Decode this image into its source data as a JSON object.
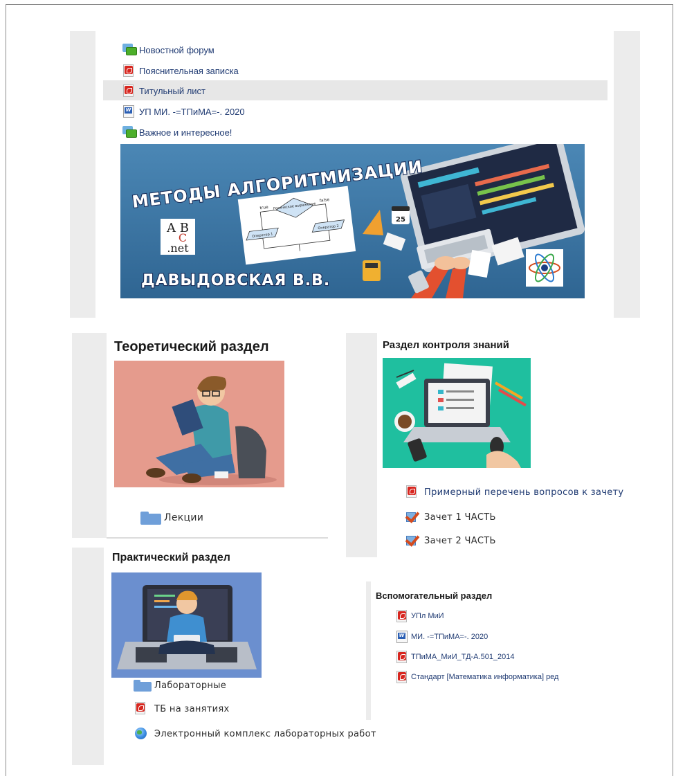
{
  "top_resources": [
    {
      "label": "Новостной форум",
      "icon": "forum-icon"
    },
    {
      "label": "Пояснительная записка",
      "icon": "pdf-icon"
    },
    {
      "label": "Титульный лист",
      "icon": "pdf-icon"
    },
    {
      "label": "УП МИ. -=ТПиМА=-. 2020",
      "icon": "word-doc-icon"
    },
    {
      "label": "Важное и интересное!",
      "icon": "forum-icon"
    }
  ],
  "banner": {
    "title": "МЕТОДЫ АЛГОРИТМИЗАЦИИ",
    "author": "ДАВЫДОВСКАЯ В.В.",
    "logo_text_1": "A B",
    "logo_text_2": "C",
    "logo_text_3": ".net",
    "flow_true": "true",
    "flow_false": "false",
    "flow_condition": "Логическое выражение",
    "flow_op1": "Оператор 1",
    "flow_op2": "Оператор 2",
    "calendar_day": "25"
  },
  "theory": {
    "title": "Теоретический раздел",
    "links": [
      {
        "label": "Лекции",
        "icon": "folder-icon"
      }
    ]
  },
  "control": {
    "title": "Раздел контроля знаний",
    "links": [
      {
        "label": "Примерный перечень вопросов к зачету",
        "icon": "pdf-icon"
      },
      {
        "label": "Зачет 1 ЧАСТЬ",
        "icon": "quiz-icon"
      },
      {
        "label": "Зачет 2 ЧАСТЬ",
        "icon": "quiz-icon"
      }
    ]
  },
  "practice": {
    "title": "Практический раздел",
    "links": [
      {
        "label": "Лабораторные",
        "icon": "folder-icon"
      },
      {
        "label": "ТБ на занятиях",
        "icon": "pdf-icon"
      },
      {
        "label": "Электронный комплекс лабораторных работ",
        "icon": "globe-icon"
      }
    ]
  },
  "auxiliary": {
    "title": "Вспомогательный раздел",
    "links": [
      {
        "label": "УПл МиИ",
        "icon": "pdf-icon"
      },
      {
        "label": "МИ. -=ТПиМА=-. 2020",
        "icon": "word-doc-icon"
      },
      {
        "label": "ТПиМА_МиИ_ТД-А.501_2014",
        "icon": "pdf-icon"
      },
      {
        "label": "Стандарт [Математика информатика] ред",
        "icon": "pdf-icon"
      }
    ]
  },
  "colors": {
    "link": "#1f3a72",
    "banner_bg": "#3d79a8",
    "section_gray": "#ececec",
    "pdf_red": "#d7261f",
    "folder_blue": "#6f9fd9"
  }
}
